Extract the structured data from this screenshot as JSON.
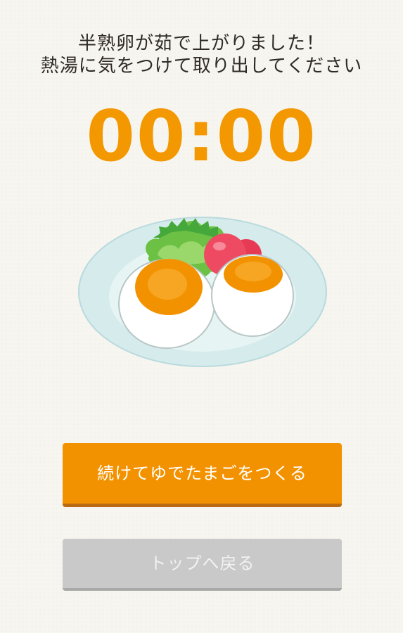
{
  "message": {
    "line1": "半熟卵が茹で上がりました！",
    "line2": "熱湯に気をつけて取り出してください"
  },
  "timer": {
    "display": "00:00"
  },
  "illustration": {
    "icon": "boiled-eggs-plate-icon"
  },
  "buttons": {
    "continue_label": "続けてゆでたまごをつくる",
    "back_to_top_label": "トップへ戻る"
  },
  "colors": {
    "accent": "#f39200",
    "background": "#f7f5ef",
    "disabled": "#c9c9c9"
  }
}
